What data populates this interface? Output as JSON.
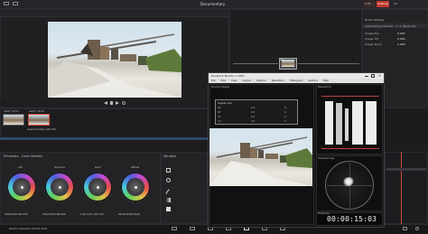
{
  "app": {
    "title": "Documentary",
    "footer_label": "DaVinci Resolve Studio 18.6"
  },
  "topbar": {
    "viewer_label": "Timeline",
    "timeline_name": "TIMELINE 1",
    "nodes_label": "Nodes",
    "lut_label": "LUTs",
    "library_label": "Lib"
  },
  "right_panel": {
    "title": "Settings",
    "tab": "Settings",
    "section": "Node Settings",
    "node_label": "Input Sizing Controls - 1 / 1 (Node 01)",
    "rows": [
      {
        "label": "Image Pan",
        "value": "0.000"
      },
      {
        "label": "Image Tilt",
        "value": "0.000"
      },
      {
        "label": "Image Zoom",
        "value": "1.000"
      }
    ]
  },
  "node_graph": {
    "node_id": "01"
  },
  "clips": [
    {
      "label": "A007_C011",
      "index": "01"
    },
    {
      "label": "A007_C012",
      "index": "02"
    }
  ],
  "clip_caption": "Apple ProRes 422 HQ",
  "color_panel": {
    "title": "Primaries - Color Wheels",
    "wheels": [
      {
        "label": "Lift",
        "values": [
          "0.00",
          "0.00",
          "0.00",
          "0.00"
        ]
      },
      {
        "label": "Gamma",
        "values": [
          "0.00",
          "0.00",
          "0.00",
          "0.00"
        ]
      },
      {
        "label": "Gain",
        "values": [
          "1.00",
          "1.00",
          "1.00",
          "1.00"
        ]
      },
      {
        "label": "Offset",
        "values": [
          "25.00",
          "25.00",
          "25.00"
        ]
      }
    ]
  },
  "window_panel": {
    "title": "Window"
  },
  "monitor_window": {
    "title": "DeckLink Monitor 1 UHD",
    "menu": [
      "File",
      "Edit",
      "View",
      "Layout",
      "Capture",
      "Waveform",
      "Histogram",
      "Vectors",
      "Help"
    ],
    "source_label": "Source Signal",
    "overlay_title": "Signal Info",
    "overlay_cells": [
      [
        "3G",
        "1/2",
        "0"
      ],
      [
        "25",
        "1/2",
        "0"
      ],
      [
        "24",
        "1/2",
        "0"
      ],
      [
        "2.1",
        "1/2",
        "0"
      ]
    ],
    "waveform_label": "Waveform",
    "vector_label": "Vectorscope",
    "timecode_label": "Timecode",
    "timecode": "00:00:15:03"
  }
}
